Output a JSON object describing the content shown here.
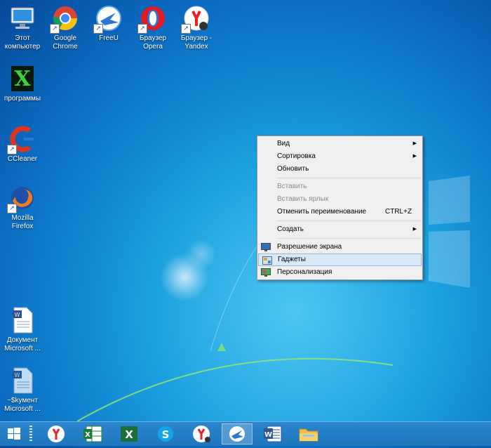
{
  "desktop": {
    "icons": [
      {
        "label": "Этот\nкомпьютер",
        "icon": "computer-icon"
      },
      {
        "label": "Google\nChrome",
        "icon": "chrome-icon"
      },
      {
        "label": "FreeU",
        "icon": "freeu-icon"
      },
      {
        "label": "Браузер\nOpera",
        "icon": "opera-icon"
      },
      {
        "label": "Браузер -\nYandex",
        "icon": "yandex-icon"
      },
      {
        "label": "программы",
        "icon": "programs-icon"
      },
      {
        "label": "CCleaner",
        "icon": "ccleaner-icon"
      },
      {
        "label": "Mozilla\nFirefox",
        "icon": "firefox-icon"
      },
      {
        "label": "Документ\nMicrosoft ...",
        "icon": "word-document-icon"
      },
      {
        "label": "~$kумент\nMicrosoft ...",
        "icon": "word-document-icon"
      }
    ]
  },
  "context_menu": {
    "items": [
      {
        "label": "Вид",
        "submenu": true
      },
      {
        "label": "Сортировка",
        "submenu": true
      },
      {
        "label": "Обновить"
      },
      {
        "label": "Вставить",
        "disabled": true
      },
      {
        "label": "Вставить ярлык",
        "disabled": true
      },
      {
        "label": "Отменить переименование",
        "shortcut": "CTRL+Z"
      },
      {
        "label": "Создать",
        "submenu": true
      },
      {
        "label": "Разрешение экрана",
        "icon": "display-icon"
      },
      {
        "label": "Гаджеты",
        "icon": "gadgets-icon",
        "highlighted": true
      },
      {
        "label": "Персонализация",
        "icon": "personalize-icon"
      }
    ]
  },
  "taskbar": {
    "items": [
      "start",
      "yandex",
      "excel-green",
      "excel",
      "skype",
      "yandex-browser",
      "freeu",
      "word",
      "explorer"
    ],
    "active": [
      "freeu"
    ],
    "skype_letter": "S",
    "excel_letter": "X",
    "word_letter": "W"
  },
  "colors": {
    "desktop": "#1ba0e0",
    "taskbar": "#1f76bd",
    "menu_highlight": "#dae9f8"
  }
}
